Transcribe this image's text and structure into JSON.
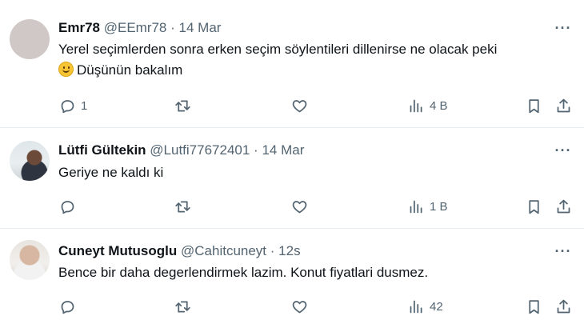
{
  "tweets": [
    {
      "name": "Emr78",
      "handle": "@EEmr78",
      "separator": "·",
      "time": "14 Mar",
      "text_line1": "Yerel seçimlerden sonra erken seçim söylentileri dillenirse ne olacak peki",
      "text_line2": "Düşünün bakalım",
      "reply_count": "1",
      "views": "4 B"
    },
    {
      "name": "Lütfi Gültekin",
      "handle": "@Lutfi77672401",
      "separator": "·",
      "time": "14 Mar",
      "text_line1": "Geriye ne kaldı ki",
      "reply_count": "",
      "views": "1 B"
    },
    {
      "name": "Cuneyt Mutusoglu",
      "handle": "@Cahitcuneyt",
      "separator": "·",
      "time": "12s",
      "text_line1": "Bence bir daha degerlendirmek lazim. Konut fiyatlari dusmez.",
      "reply_count": "",
      "views": "42"
    }
  ],
  "icons": {
    "reply": "speech-bubble",
    "retweet": "retweet-arrows",
    "like": "heart",
    "views": "bar-chart",
    "bookmark": "bookmark",
    "share": "upload-arrow",
    "more": "ellipsis"
  },
  "more_label": "···"
}
